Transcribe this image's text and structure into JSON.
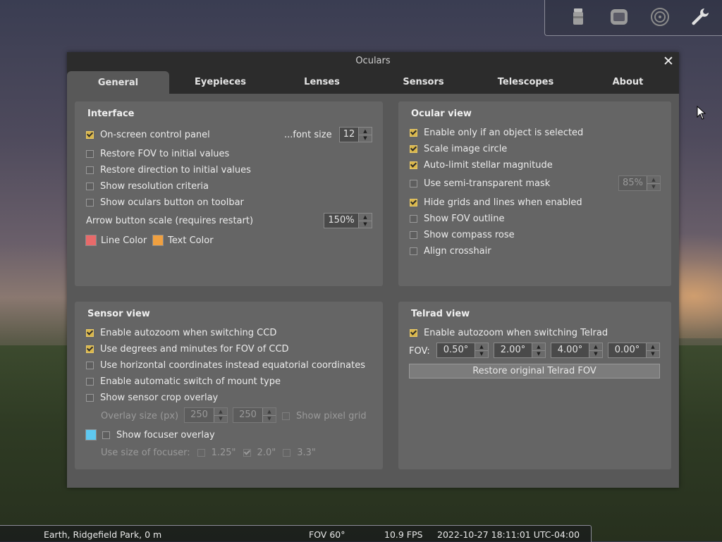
{
  "dialog": {
    "title": "Oculars",
    "close_label": "✕",
    "tabs": [
      {
        "label": "General",
        "active": true
      },
      {
        "label": "Eyepieces",
        "active": false
      },
      {
        "label": "Lenses",
        "active": false
      },
      {
        "label": "Sensors",
        "active": false
      },
      {
        "label": "Telescopes",
        "active": false
      },
      {
        "label": "About",
        "active": false
      }
    ]
  },
  "interface": {
    "title": "Interface",
    "onscreen_label": "On-screen control panel",
    "onscreen_checked": true,
    "font_size_label": "...font size",
    "font_size_value": "12",
    "restore_fov_label": "Restore FOV to initial values",
    "restore_direction_label": "Restore direction to initial values",
    "show_resolution_label": "Show resolution criteria",
    "show_oculars_button_label": "Show oculars button on toolbar",
    "arrow_scale_label": "Arrow button scale (requires restart)",
    "arrow_scale_value": "150%",
    "line_color_label": "Line Color",
    "line_color": "#e86a6a",
    "text_color_label": "Text Color",
    "text_color": "#f0a040"
  },
  "ocular_view": {
    "title": "Ocular view",
    "enable_only_label": "Enable only if an object is selected",
    "scale_circle_label": "Scale image circle",
    "auto_limit_label": "Auto-limit stellar magnitude",
    "semi_mask_label": "Use semi-transparent mask",
    "semi_mask_value": "85%",
    "hide_grids_label": "Hide grids and lines when enabled",
    "show_fov_outline_label": "Show FOV outline",
    "show_compass_label": "Show compass rose",
    "align_crosshair_label": "Align crosshair"
  },
  "sensor_view": {
    "title": "Sensor view",
    "autozoom_ccd_label": "Enable autozoom when switching CCD",
    "degrees_minutes_label": "Use degrees and minutes for FOV of CCD",
    "horizontal_coords_label": "Use horizontal coordinates instead equatorial coordinates",
    "auto_mount_label": "Enable automatic switch of mount type",
    "crop_overlay_label": "Show sensor crop overlay",
    "overlay_size_label": "Overlay size (px)",
    "overlay_width": "250",
    "overlay_height": "250",
    "pixel_grid_label": "Show pixel grid",
    "focuser_overlay_label": "Show focuser overlay",
    "focuser_color": "#5ec8f0",
    "focuser_size_label": "Use size of focuser:",
    "size_125": "1.25\"",
    "size_20": "2.0\"",
    "size_33": "3.3\""
  },
  "telrad_view": {
    "title": "Telrad view",
    "autozoom_telrad_label": "Enable autozoom when switching Telrad",
    "fov_label": "FOV:",
    "fov_values": [
      "0.50°",
      "2.00°",
      "4.00°",
      "0.00°"
    ],
    "restore_button": "Restore original Telrad FOV"
  },
  "statusbar": {
    "location": "Earth, Ridgefield Park, 0 m",
    "fov": "FOV 60°",
    "fps": "10.9 FPS",
    "datetime": "2022-10-27 18:11:01 UTC-04:00"
  },
  "toolbar_icons": [
    "ocular-icon",
    "sensor-frame-icon",
    "telrad-icon",
    "wrench-icon"
  ],
  "colors": {
    "checkbox_checked": "#d9b64a",
    "panel_bg": "#656565",
    "dialog_bg": "#585858",
    "titlebar_bg": "#2c2c2c"
  }
}
